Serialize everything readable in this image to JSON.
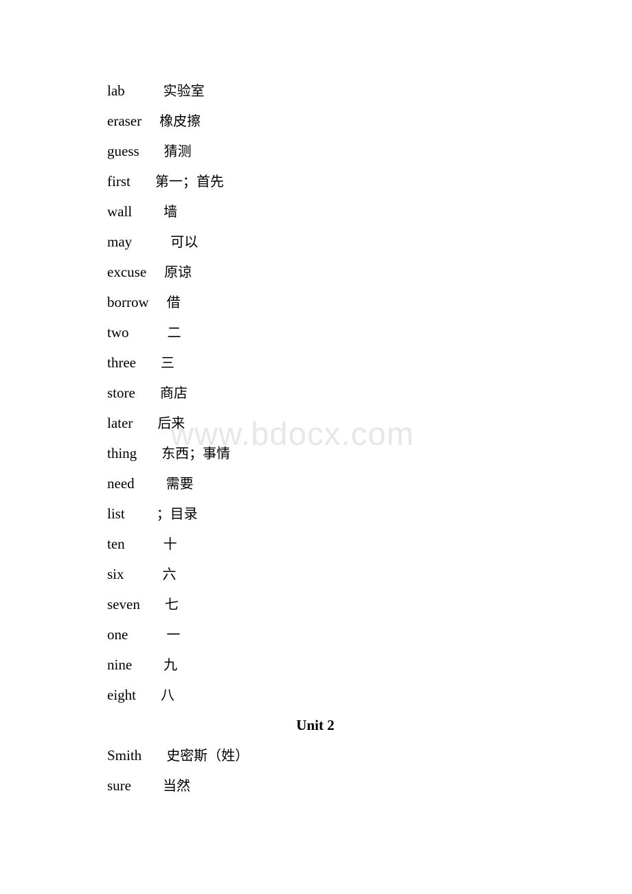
{
  "document": {
    "watermark": "www.bdocx.com",
    "watermark_color": "#e7e7e7",
    "text_color": "#000000",
    "background_color": "#ffffff"
  },
  "entries": [
    {
      "term": "lab",
      "gloss": "实验室"
    },
    {
      "term": "eraser",
      "gloss": "橡皮擦"
    },
    {
      "term": "guess",
      "gloss": "猜测"
    },
    {
      "term": "first",
      "gloss": "第一；首先"
    },
    {
      "term": "wall",
      "gloss": "墙"
    },
    {
      "term": "may",
      "gloss": "可以"
    },
    {
      "term": "excuse",
      "gloss": "原谅"
    },
    {
      "term": "borrow",
      "gloss": "借"
    },
    {
      "term": "two",
      "gloss": "二"
    },
    {
      "term": "three",
      "gloss": "三"
    },
    {
      "term": "store",
      "gloss": "商店"
    },
    {
      "term": "later",
      "gloss": "后来"
    },
    {
      "term": "thing",
      "gloss": "东西；事情"
    },
    {
      "term": "need",
      "gloss": "需要"
    },
    {
      "term": "list",
      "gloss": "；目录"
    },
    {
      "term": "ten",
      "gloss": "十"
    },
    {
      "term": "six",
      "gloss": "六"
    },
    {
      "term": "seven",
      "gloss": "七"
    },
    {
      "term": "one",
      "gloss": "一"
    },
    {
      "term": "nine",
      "gloss": "九"
    },
    {
      "term": "eight",
      "gloss": "八"
    }
  ],
  "unit_heading": "Unit 2",
  "entries_after_heading": [
    {
      "term": "Smith",
      "gloss": "史密斯（姓）"
    },
    {
      "term": "sure",
      "gloss": "当然"
    }
  ]
}
